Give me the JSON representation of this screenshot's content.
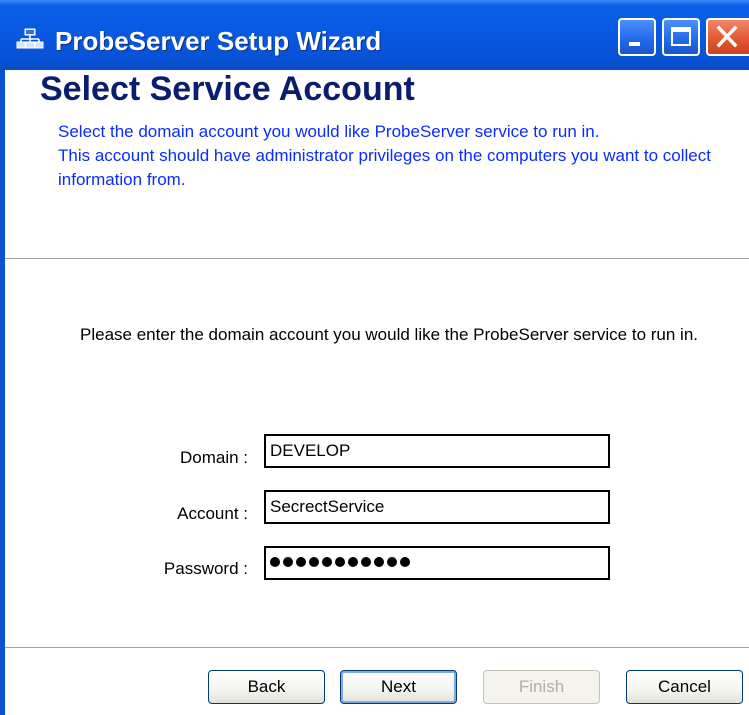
{
  "window": {
    "title": "ProbeServer Setup Wizard"
  },
  "header": {
    "title": "Select Service Account",
    "description": "Select the domain account you would like ProbeServer service to run in.\n This account should have administrator privileges on the computers you want to collect information from."
  },
  "body": {
    "instruction": "Please enter the domain account you would like the ProbeServer service to run in.",
    "fields": {
      "domain": {
        "label": "Domain :",
        "value": "DEVELOP"
      },
      "account": {
        "label": "Account :",
        "value": "SecrectService"
      },
      "password": {
        "label": "Password :",
        "masked_length": 11
      }
    }
  },
  "footer": {
    "back_label": "Back",
    "next_label": "Next",
    "finish_label": "Finish",
    "cancel_label": "Cancel"
  },
  "colors": {
    "title_bar": "#0858e0",
    "header_title": "#0a1d6e",
    "header_description": "#0a2cff",
    "close_button": "#e25a35"
  },
  "icons": {
    "app": "network-computers-icon",
    "minimize": "minimize-icon",
    "maximize": "maximize-icon",
    "close": "close-icon"
  }
}
